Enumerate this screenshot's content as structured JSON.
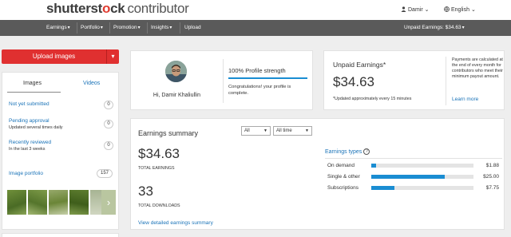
{
  "header": {
    "logo_brand_a": "shutterst",
    "logo_brand_accent": "o",
    "logo_brand_b": "ck",
    "logo_sub": "contributor",
    "user_name": "Damir",
    "language": "English"
  },
  "nav": {
    "items": [
      {
        "label": "Earnings",
        "dropdown": true
      },
      {
        "label": "Portfolio",
        "dropdown": true
      },
      {
        "label": "Promotion",
        "dropdown": true
      },
      {
        "label": "Insights",
        "dropdown": true
      },
      {
        "label": "Upload",
        "dropdown": false
      }
    ],
    "unpaid_earnings": "Unpaid Earnings: $34.63"
  },
  "left": {
    "upload_button": "Upload images",
    "tabs": {
      "images": "Images",
      "videos": "Videos"
    },
    "rows": [
      {
        "title": "Not yet submitted",
        "desc": "",
        "count": "0"
      },
      {
        "title": "Pending approval",
        "desc": "Updated several times daily",
        "count": "0"
      },
      {
        "title": "Recently reviewed",
        "desc": "In the last 3 weeks",
        "count": "0"
      }
    ],
    "portfolio": {
      "label": "Image portfolio",
      "count": "157"
    }
  },
  "profile": {
    "greeting": "Hi, Damir Khaliullin",
    "strength": "100% Profile strength",
    "strength_percent": 100,
    "message": "Congratulations! your profile is complete."
  },
  "unpaid": {
    "title": "Unpaid Earnings*",
    "amount": "$34.63",
    "note": "*Updated approximately every 15 minutes",
    "info": "Payments are calculated at the end of every month for contributors who meet their minimum payout amount.",
    "learn_more": "Learn more"
  },
  "summary": {
    "title": "Earnings summary",
    "filter_type": "All",
    "filter_period": "All time",
    "total_earnings": "$34.63",
    "total_earnings_label": "TOTAL EARNINGS",
    "total_downloads": "33",
    "total_downloads_label": "TOTAL DOWNLOADS",
    "detailed_link": "View detailed earnings summary",
    "types_title": "Earnings types",
    "types": [
      {
        "label": "On demand",
        "value": "$1.88",
        "fill": 0.05
      },
      {
        "label": "Single & other",
        "value": "$25.00",
        "fill": 0.72
      },
      {
        "label": "Subscriptions",
        "value": "$7.75",
        "fill": 0.23
      }
    ]
  },
  "colors": {
    "accent_red": "#e03030",
    "nav_bg": "#5a5a5a",
    "link_blue": "#1a73b8",
    "bar_blue": "#1a8dd2"
  }
}
